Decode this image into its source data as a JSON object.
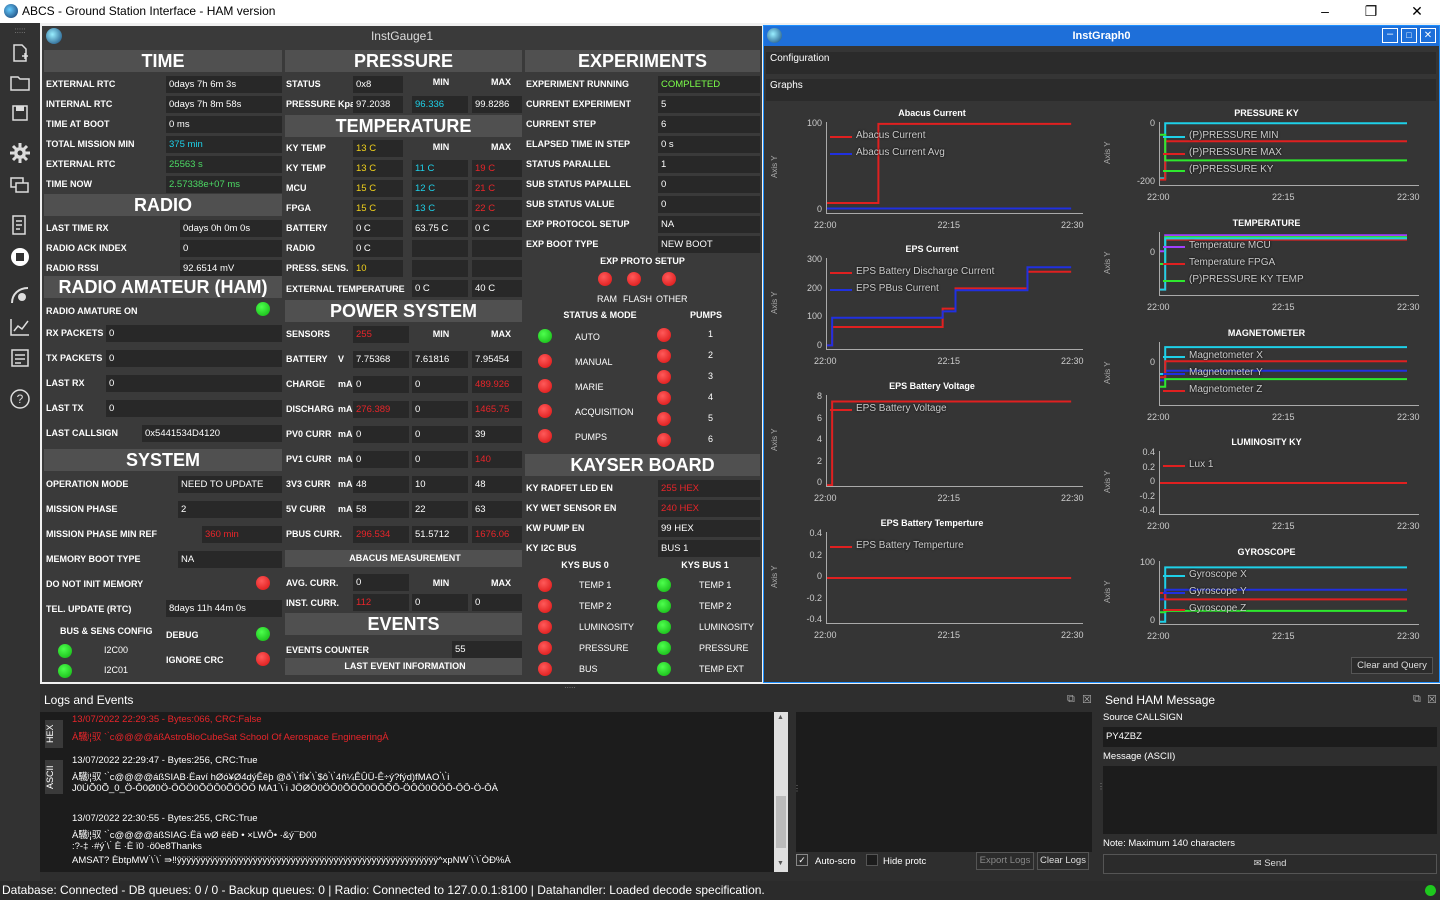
{
  "window": {
    "title": "ABCS - Ground Station Interface - HAM version",
    "min": "–",
    "max": "❐",
    "close": "✕"
  },
  "gauge": {
    "title": "InstGauge1",
    "time": {
      "header": "TIME",
      "rows": [
        {
          "label": "EXTERNAL RTC",
          "value": "0days 7h 6m 3s",
          "color": ""
        },
        {
          "label": "INTERNAL RTC",
          "value": "0days 7h 8m 58s",
          "color": ""
        },
        {
          "label": "TIME AT BOOT",
          "value": "0 ms",
          "color": ""
        },
        {
          "label": "TOTAL MISSION MIN",
          "value": "375 min",
          "color": "cyan"
        },
        {
          "label": "EXTERNAL RTC",
          "value": "25563 s",
          "color": "green"
        },
        {
          "label": "TIME NOW",
          "value": "2.57338e+07 ms",
          "color": "green"
        }
      ]
    },
    "radio": {
      "header": "RADIO",
      "rows": [
        {
          "label": "LAST TIME RX",
          "value": "0days 0h 0m 0s"
        },
        {
          "label": "RADIO ACK INDEX",
          "value": "0"
        },
        {
          "label": "RADIO RSSI",
          "value": "92.6514 mV"
        }
      ]
    },
    "ham": {
      "header": "RADIO AMATEUR (HAM)",
      "on_label": "RADIO AMATURE ON",
      "rows": [
        {
          "label": "RX PACKETS",
          "value": "0"
        },
        {
          "label": "TX PACKETS",
          "value": "0"
        },
        {
          "label": "LAST RX",
          "value": "0"
        },
        {
          "label": "LAST TX",
          "value": "0"
        },
        {
          "label": "LAST CALLSIGN",
          "value": "0x5441534D4120"
        }
      ]
    },
    "system": {
      "header": "SYSTEM",
      "rows": [
        {
          "label": "OPERATION MODE",
          "value": "NEED TO UPDATE",
          "color": ""
        },
        {
          "label": "MISSION PHASE",
          "value": "2",
          "color": ""
        },
        {
          "label": "MISSION PHASE MIN REF",
          "value": "360 min",
          "color": "red"
        },
        {
          "label": "MEMORY BOOT TYPE",
          "value": "NA",
          "color": ""
        }
      ],
      "no_init": "DO NOT INIT MEMORY",
      "tel": "TEL. UPDATE (RTC)",
      "tel_value": "8days 11h 44m 0s",
      "bus_cfg": "BUS & SENS CONFIG",
      "debug": "DEBUG",
      "ignore_crc": "IGNORE CRC",
      "i2c00": "I2C00",
      "i2c01": "I2C01"
    },
    "pressure": {
      "header": "PRESSURE",
      "min": "MIN",
      "max": "MAX",
      "status_label": "STATUS",
      "status": "0x8",
      "kpa_label": "PRESSURE Kpa",
      "kpa": "97.2038",
      "kpa_min": "96.336",
      "kpa_max": "99.8286"
    },
    "temperature": {
      "header": "TEMPERATURE",
      "min": "MIN",
      "max": "MAX",
      "rows": [
        {
          "label": "KY TEMP",
          "v": "13 C",
          "mn": "",
          "mx": "",
          "vc": "yellow",
          "mnc": "",
          "mxc": ""
        },
        {
          "label": "KY TEMP",
          "v": "13 C",
          "mn": "11 C",
          "mx": "19 C",
          "vc": "yellow",
          "mnc": "cyan",
          "mxc": "red"
        },
        {
          "label": "MCU",
          "v": "15 C",
          "mn": "12 C",
          "mx": "21 C",
          "vc": "yellow",
          "mnc": "cyan",
          "mxc": "red"
        },
        {
          "label": "FPGA",
          "v": "15 C",
          "mn": "13 C",
          "mx": "22 C",
          "vc": "yellow",
          "mnc": "cyan",
          "mxc": "red"
        },
        {
          "label": "BATTERY",
          "v": "0 C",
          "mn": "63.75 C",
          "mx": "0 C",
          "vc": "",
          "mnc": "",
          "mxc": ""
        },
        {
          "label": "RADIO",
          "v": "0 C",
          "mn": "",
          "mx": "",
          "vc": "",
          "mnc": "",
          "mxc": ""
        },
        {
          "label": "PRESS. SENS.",
          "v": "10",
          "mn": "",
          "mx": "",
          "vc": "yellow",
          "mnc": "",
          "mxc": ""
        }
      ],
      "ext_label": "EXTERNAL TEMPERATURE",
      "ext_min": "0 C",
      "ext_max": "40 C"
    },
    "power": {
      "header": "POWER SYSTEM",
      "min": "MIN",
      "max": "MAX",
      "rows": [
        {
          "label": "SENSORS",
          "unit": "",
          "v": "255",
          "mn": "",
          "mx": "",
          "vc": "red",
          "mnc": "",
          "mxc": ""
        },
        {
          "label": "BATTERY",
          "unit": "V",
          "v": "7.75368",
          "mn": "7.61816",
          "mx": "7.95454",
          "vc": "",
          "mnc": "",
          "mxc": ""
        },
        {
          "label": "CHARGE",
          "unit": "mA",
          "v": "0",
          "mn": "0",
          "mx": "489.926",
          "vc": "",
          "mnc": "",
          "mxc": "red"
        },
        {
          "label": "DISCHARG",
          "unit": "mA",
          "v": "276.389",
          "mn": "0",
          "mx": "1465.75",
          "vc": "red",
          "mnc": "",
          "mxc": "red"
        },
        {
          "label": "PV0 CURR",
          "unit": "mA",
          "v": "0",
          "mn": "0",
          "mx": "39",
          "vc": "",
          "mnc": "",
          "mxc": ""
        },
        {
          "label": "PV1 CURR",
          "unit": "mA",
          "v": "0",
          "mn": "0",
          "mx": "140",
          "vc": "",
          "mnc": "",
          "mxc": "red"
        },
        {
          "label": "3V3 CURR",
          "unit": "mA",
          "v": "48",
          "mn": "10",
          "mx": "48",
          "vc": "",
          "mnc": "",
          "mxc": ""
        },
        {
          "label": "5V CURR",
          "unit": "mA",
          "v": "58",
          "mn": "22",
          "mx": "63",
          "vc": "",
          "mnc": "",
          "mxc": ""
        },
        {
          "label": "PBUS CURR.",
          "unit": "",
          "v": "296.534",
          "mn": "51.5712",
          "mx": "1676.06",
          "vc": "red",
          "mnc": "",
          "mxc": "red"
        }
      ]
    },
    "abacus": {
      "header": "ABACUS MEASUREMENT",
      "min": "MIN",
      "max": "MAX",
      "avg_label": "AVG. CURR.",
      "avg": "0",
      "inst_label": "INST. CURR.",
      "inst": "112",
      "inst_min": "0",
      "inst_max": "0"
    },
    "events": {
      "header": "EVENTS",
      "counter_label": "EVENTS COUNTER",
      "counter": "55",
      "last": "LAST EVENT INFORMATION"
    },
    "experiments": {
      "header": "EXPERIMENTS",
      "rows": [
        {
          "label": "EXPERIMENT RUNNING",
          "value": "COMPLETED",
          "color": "lime"
        },
        {
          "label": "CURRENT EXPERIMENT",
          "value": "5",
          "color": ""
        },
        {
          "label": "CURRENT STEP",
          "value": "6",
          "color": ""
        },
        {
          "label": "ELAPSED TIME IN STEP",
          "value": "0 s",
          "color": ""
        },
        {
          "label": "STATUS PARALLEL",
          "value": "1",
          "color": ""
        },
        {
          "label": "SUB STATUS PAPALLEL",
          "value": "0",
          "color": ""
        },
        {
          "label": "SUB STATUS VALUE",
          "value": "0",
          "color": ""
        },
        {
          "label": "EXP PROTOCOL SETUP",
          "value": "NA",
          "color": ""
        },
        {
          "label": "EXP BOOT TYPE",
          "value": "NEW BOOT",
          "color": ""
        }
      ],
      "proto_setup": "EXP PROTO SETUP",
      "ram": "RAM",
      "flash": "FLASH",
      "other": "OTHER",
      "status_mode": "STATUS & MODE",
      "pumps": "PUMPS",
      "modes": [
        "AUTO",
        "MANUAL",
        "MARIE",
        "ACQUISITION",
        "PUMPS"
      ],
      "pump_nums": [
        "1",
        "2",
        "3",
        "4",
        "5",
        "6"
      ]
    },
    "kayser": {
      "header": "KAYSER BOARD",
      "rows": [
        {
          "label": "KY RADFET LED EN",
          "value": "255 HEX",
          "color": "red"
        },
        {
          "label": "KY WET SENSOR EN",
          "value": "240 HEX",
          "color": "red"
        },
        {
          "label": "KW PUMP EN",
          "value": "99 HEX",
          "color": ""
        },
        {
          "label": "KY I2C BUS",
          "value": "BUS 1",
          "color": ""
        }
      ],
      "bus0": "KYS BUS 0",
      "bus1": "KYS BUS 1",
      "bus0_items": [
        "TEMP 1",
        "TEMP 2",
        "LUMINOSITY",
        "PRESSURE",
        "BUS"
      ],
      "bus1_items": [
        "TEMP 1",
        "TEMP 2",
        "LUMINOSITY",
        "PRESSURE",
        "TEMP EXT"
      ]
    }
  },
  "graph": {
    "title": "InstGraph0",
    "config_tab": "Configuration",
    "graphs_tab": "Graphs",
    "clear_btn": "Clear and Query",
    "axis_y": "Axis Y",
    "charts": [
      {
        "title": "Abacus Current",
        "xt": [
          "22:00",
          "22:15",
          "22:30"
        ],
        "yt": [
          "100",
          "0"
        ],
        "legend": [
          "Abacus Current",
          "Abacus Current Avg"
        ]
      },
      {
        "title": "EPS Current",
        "xt": [
          "22:00",
          "22:15",
          "22:30"
        ],
        "yt": [
          "300",
          "200",
          "100",
          "0"
        ],
        "legend": [
          "EPS Battery Discharge Current",
          "EPS PBus Current"
        ]
      },
      {
        "title": "EPS Battery Voltage",
        "xt": [
          "22:00",
          "22:15",
          "22:30"
        ],
        "yt": [
          "8",
          "6",
          "4",
          "2",
          "0"
        ],
        "legend": [
          "EPS Battery Voltage"
        ]
      },
      {
        "title": "EPS Battery Temperture",
        "xt": [
          "22:00",
          "22:15",
          "22:30"
        ],
        "yt": [
          "0.4",
          "0.2",
          "0",
          "-0.2",
          "-0.4"
        ],
        "legend": [
          "EPS Battery Temperture"
        ]
      },
      {
        "title": "PRESSURE KY",
        "xt": [
          "22:00",
          "22:15",
          "22:30"
        ],
        "yt": [
          "0",
          "-200"
        ],
        "legend": [
          "(P)PRESSURE MIN",
          "(P)PRESSURE MAX",
          "(P)PRESSURE KY"
        ]
      },
      {
        "title": "TEMPERATURE",
        "xt": [
          "22:00",
          "22:15",
          "22:30"
        ],
        "yt": [
          "0"
        ],
        "legend": [
          "Temperature MCU",
          "Temperature FPGA",
          "(P)PRESSURE KY TEMP"
        ]
      },
      {
        "title": "MAGNETOMETER",
        "xt": [
          "22:00",
          "22:15",
          "22:30"
        ],
        "yt": [
          "0"
        ],
        "legend": [
          "Magnetometer X",
          "Magnetometer Y",
          "Magnetometer Z"
        ]
      },
      {
        "title": "LUMINOSITY KY",
        "xt": [
          "22:00",
          "22:15",
          "22:30"
        ],
        "yt": [
          "0.4",
          "0.2",
          "0",
          "-0.2",
          "-0.4"
        ],
        "legend": [
          "Lux 1"
        ]
      },
      {
        "title": "GYROSCOPE",
        "xt": [
          "22:00",
          "22:15",
          "22:30"
        ],
        "yt": [
          "100",
          "0"
        ],
        "legend": [
          "Gyroscope X",
          "Gyroscope Y",
          "Gyroscope Z"
        ]
      }
    ]
  },
  "logs": {
    "title": "Logs and Events",
    "tab_hex": "HEX",
    "tab_ascii": "ASCII",
    "lines": [
      {
        "text": "13/07/2022 22:29:35 - Bytes:066, CRC:False",
        "color": "red"
      },
      {
        "text": "À驖ʲ¦驭 ` ̀c@@@@áßAstroBioCubeSat School Of Aerospace EngineeringÀ",
        "color": "red"
      },
      {
        "text": "13/07/2022 22:29:47 - Bytes:256, CRC:True",
        "color": ""
      },
      {
        "text": "À驖ʲ¦驭 ` ̀c@@@@áßSIAB·Ëaví  hØó¥Ø4dýÊêþ  @ð ̀\\ ̀fÍ¥ ̀\\ ̀$ô ̀\\ ̀4ñ¼ÊÛÜ-Ê÷ý?fýd)fMAO ̀\\ ̀i",
        "color": ""
      },
      {
        "text": "J0ÙÕ0Õ_0_Ö-Ô0Ø0Ö-ÖÔÖ0ÕÖÔ0ÕÖÔÖ  MA1 ̀\\ ̀i  JÖØÖ0ÖÔ0ÕÖÔ0ÖÔÕÔ-ÖÔÖ0ÔÖÔ-ÔÔ-Ö-ÔÀ",
        "color": ""
      },
      {
        "text": "13/07/2022 22:30:55 - Bytes:255, CRC:True",
        "color": ""
      },
      {
        "text": "À驖ʲ¦驭 ` ̀c@@@@áßSIAG·Ëä  wØ  ëêÐ • ×LWÔ• ·&ý¯Ð00",
        "color": ""
      },
      {
        "text": ":?-‡ ·#ý ̀\\ ̀  È ·È     ï0                      ·ö0e8Thanks",
        "color": ""
      },
      {
        "text": "AMSAT?  ÈbtpMW ̀\\ ̀\\ ̀   ⇛‼ŷÿÿÿÿÿÿÿÿÿÿÿÿÿÿÿÿÿÿÿÿÿÿÿÿÿÿÿÿÿÿÿÿÿÿÿÿÿÿÿÿÿÿÿÿÿÿÿÿÿÿÿÿÿÿ^xpNW ̀\\ ̀\\ ̀ÒÐ%À",
        "color": ""
      }
    ],
    "auto_scroll": "Auto-scro",
    "hide_proto": "Hide protc",
    "export": "Export Logs",
    "clear": "Clear Logs"
  },
  "ham_panel": {
    "title": "Send HAM Message",
    "source_label": "Source CALLSIGN",
    "source": "PY4ZBZ",
    "msg_label": "Message (ASCII)",
    "note": "Note: Maximum 140 characters",
    "send": "Send"
  },
  "status": "Database: Connected - DB queues: 0 / 0 - Backup queues: 0 |  Radio: Connected to 127.0.0.1:8100 |  Datahandler: Loaded decode specification."
}
